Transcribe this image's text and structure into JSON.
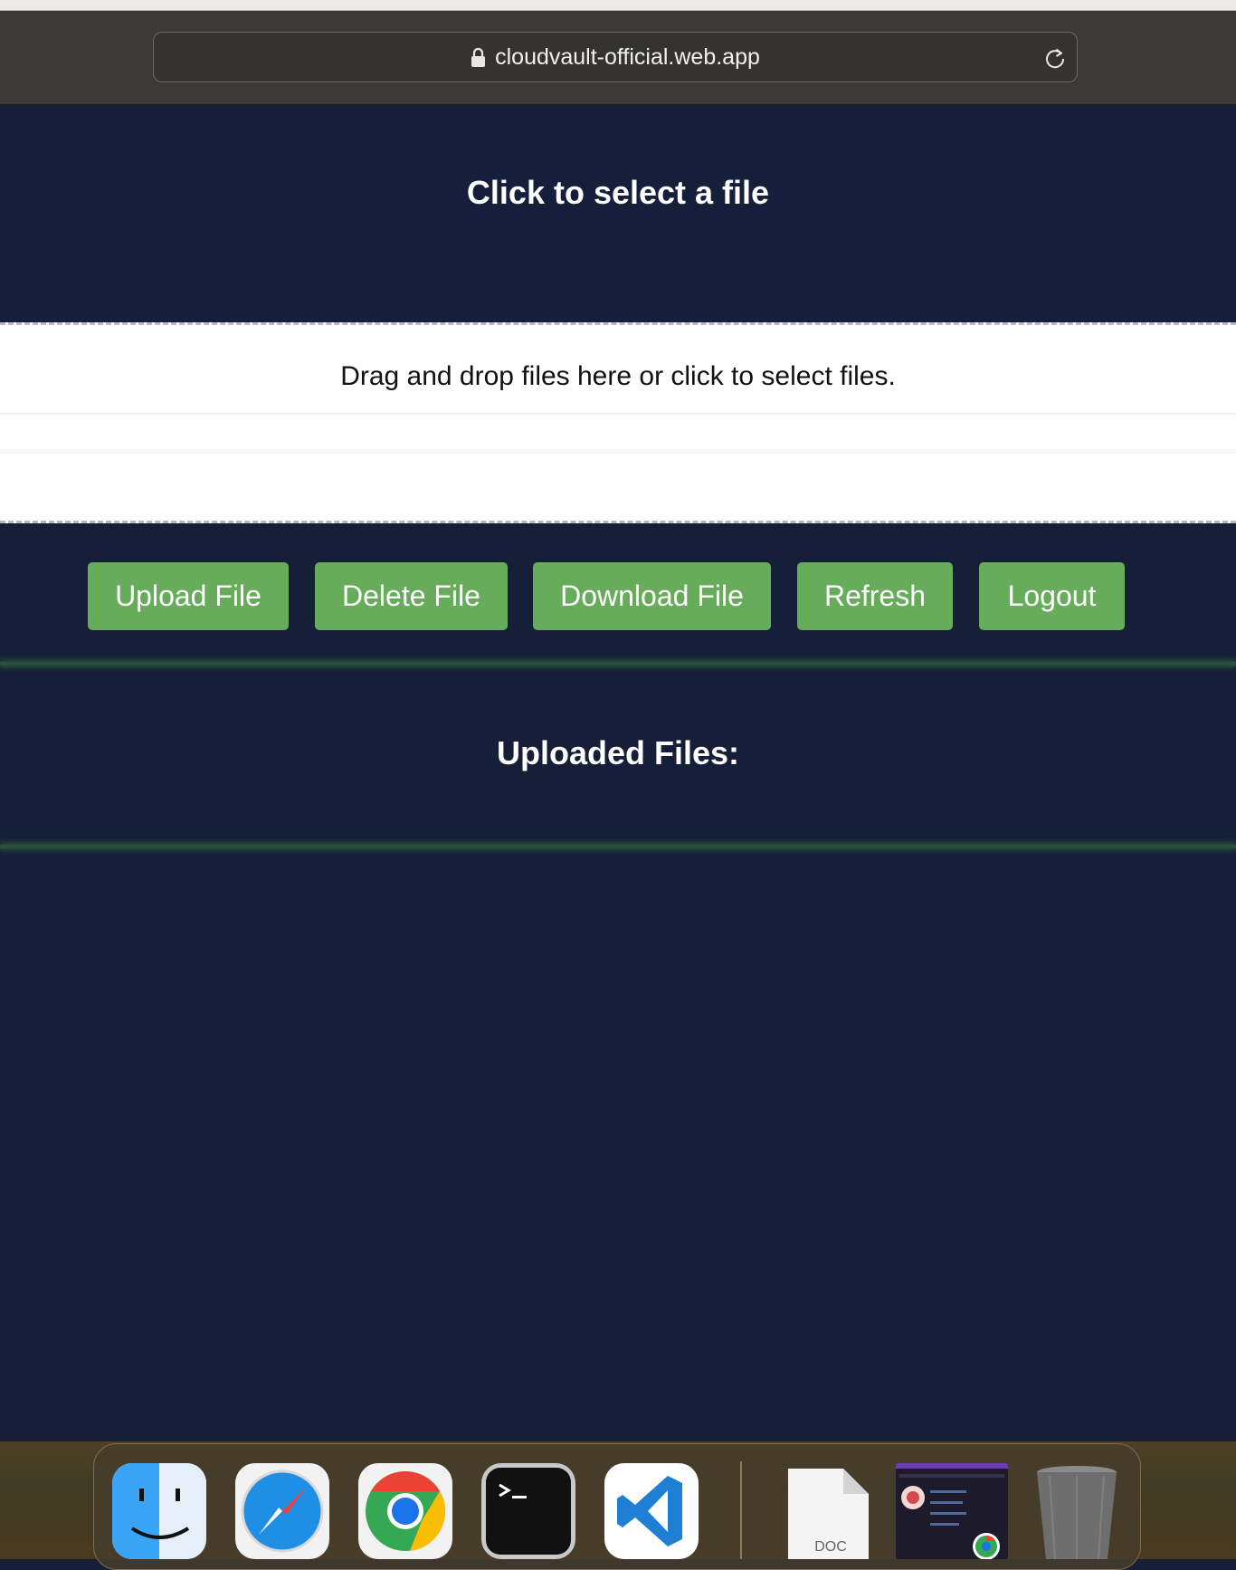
{
  "browser": {
    "url": "cloudvault-official.web.app"
  },
  "header": {
    "title": "Click to select a file"
  },
  "dropzone": {
    "text": "Drag and drop files here or click to select files."
  },
  "actions": {
    "upload": "Upload File",
    "delete": "Delete File",
    "download": "Download File",
    "refresh": "Refresh",
    "logout": "Logout"
  },
  "files": {
    "title": "Uploaded Files:",
    "items": []
  },
  "dock": {
    "apps": [
      "finder-icon",
      "safari-icon",
      "chrome-icon",
      "terminal-icon",
      "vscode-icon"
    ],
    "doc_label": "DOC",
    "extras": [
      "doc-file-icon",
      "browser-window-thumbnail",
      "trash-icon"
    ]
  },
  "colors": {
    "page_bg": "#151f38",
    "button_green": "#67ac5b",
    "dropzone_bg": "#ffffff"
  }
}
